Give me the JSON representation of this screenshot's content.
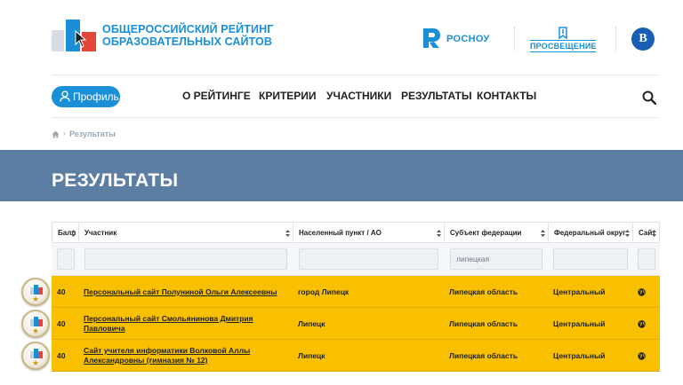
{
  "header": {
    "title_line1": "ОБЩЕРОССИЙСКИЙ РЕЙТИНГ",
    "title_line2": "ОБРАЗОВАТЕЛЬНЫХ САЙТОВ",
    "partners": {
      "rosnou": "РОСНОУ",
      "prosv": "ПРОСВЕЩЕНИЕ",
      "hse_glyph": "В"
    }
  },
  "nav": {
    "profile_label": "Профиль",
    "items": [
      "О РЕЙТИНГЕ",
      "КРИТЕРИИ",
      "УЧАСТНИКИ",
      "РЕЗУЛЬТАТЫ",
      "КОНТАКТЫ"
    ]
  },
  "breadcrumb": {
    "separator": "›",
    "current": "Результаты"
  },
  "page_title": "РЕЗУЛЬТАТЫ",
  "table": {
    "columns": [
      "Балл",
      "Участник",
      "Населенный пункт / АО",
      "Субъект федерации",
      "Федеральный округ",
      "Сайт"
    ],
    "filters": [
      "",
      "",
      "",
      "липецкая",
      "",
      ""
    ],
    "rows": [
      {
        "score": "40",
        "participant": "Персональный сайт Полуниной Ольги Алексеевны",
        "city": "город Липецк",
        "region": "Липецкая область",
        "district": "Центральный"
      },
      {
        "score": "40",
        "participant": "Персональный сайт Смольянинова Дмитрия Павловича",
        "city": "Липецк",
        "region": "Липецкая область",
        "district": "Центральный"
      },
      {
        "score": "40",
        "participant": "Сайт учителя информатики Волковой Аллы Александровны (гимназия № 12)",
        "city": "Липецк",
        "region": "Липецкая область",
        "district": "Центральный"
      }
    ]
  },
  "colors": {
    "brand_blue": "#1a8fd8",
    "banner": "#5c7ea3",
    "highlight_row": "#f8c000"
  },
  "icons": [
    "logo-icon",
    "user-icon",
    "search-icon",
    "home-icon",
    "sort-icon",
    "globe-icon",
    "medal-icon"
  ]
}
